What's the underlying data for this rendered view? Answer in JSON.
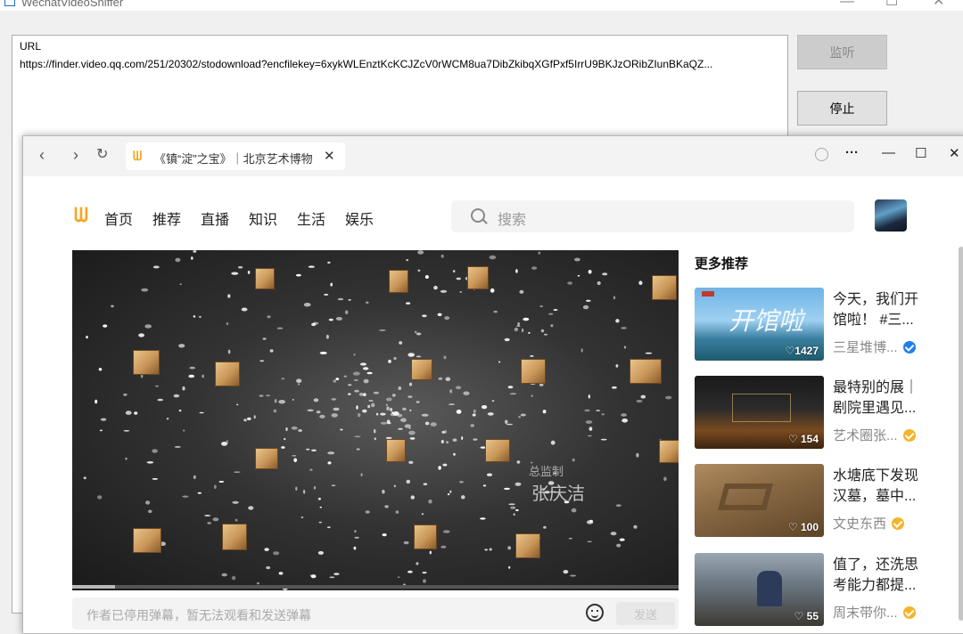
{
  "sniffer": {
    "title": "WechatVideoSniffer",
    "url_label": "URL",
    "url_value": "https://finder.video.qq.com/251/20302/stodownload?encfilekey=6xykWLEnztKcKCJZcV0rWCM8ua7DibZkibqXGfPxf5IrrU9BKJzORibZIunBKaQZ...",
    "listen_button": "监听",
    "stop_button": "停止",
    "controls": {
      "minimize": "—",
      "maximize": "☐",
      "close": "✕"
    }
  },
  "browser": {
    "tab_title": "《镇“淀”之宝》｜北京艺术博物",
    "tab_close": "✕",
    "controls": {
      "more": "···",
      "minimize": "—",
      "maximize": "☐",
      "close": "✕"
    }
  },
  "page": {
    "nav": [
      "首页",
      "推荐",
      "直播",
      "知识",
      "生活",
      "娱乐"
    ],
    "search_placeholder": "搜索",
    "video": {
      "credit_label": "总监制",
      "credit_name": "张庆洁",
      "progress": 0.07
    },
    "danmaku_placeholder": "作者已停用弹幕，暂无法观看和发送弹幕",
    "send_button": "发送",
    "rec_heading": "更多推荐",
    "recommendations": [
      {
        "text": "今天，我们开馆啦！ #三...",
        "author": "三星堆博...",
        "likes": "♡1427",
        "badge_color": "#1f7ef0"
      },
      {
        "text": "最特别的展｜剧院里遇见...",
        "author": "艺术圈张...",
        "likes": "♡ 154",
        "badge_color": "#f5b42a"
      },
      {
        "text": "水塘底下发现汉墓，墓中...",
        "author": "文史东西",
        "likes": "♡ 100",
        "badge_color": "#f5b42a"
      },
      {
        "text": "值了，还洗思考能力都提...",
        "author": "周末带你...",
        "likes": "♡ 55",
        "badge_color": "#f5b42a"
      }
    ]
  }
}
